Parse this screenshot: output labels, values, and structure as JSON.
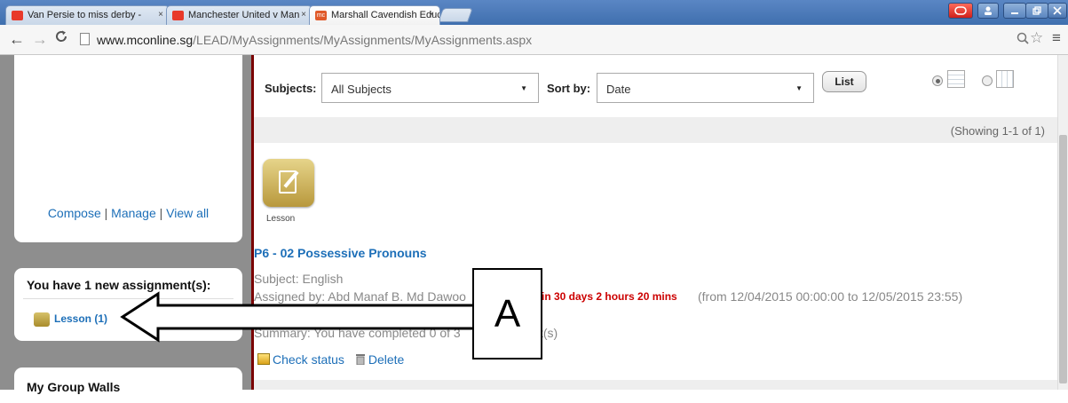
{
  "browser": {
    "tabs": [
      {
        "title": "Van Persie to miss derby -",
        "favicon_color": "#e8392a"
      },
      {
        "title": "Manchester United v Man",
        "favicon_color": "#e8392a"
      },
      {
        "title": "Marshall Cavendish Educa",
        "favicon_color": "#e05a2a",
        "favicon_text": "mc"
      }
    ],
    "close_glyph": "×",
    "url_host": "www.mconline.sg",
    "url_path": "/LEAD/MyAssignments/MyAssignments/MyAssignments.aspx"
  },
  "sidebar": {
    "compose": "Compose",
    "manage": "Manage",
    "view_all": "View all",
    "assignments_title": "You have 1 new assignment(s):",
    "lesson_link": "Lesson (1)",
    "group_walls_title": "My Group Walls"
  },
  "filters": {
    "subjects_label": "Subjects:",
    "subjects_value": "All Subjects",
    "sortby_label": "Sort by:",
    "sortby_value": "Date",
    "list_button": "List",
    "view_list_selected": true
  },
  "results": {
    "showing": "(Showing 1-1 of 1)"
  },
  "assignment": {
    "type_caption": "Lesson",
    "title": "P6 - 02 Possessive Pronouns",
    "subject": "Subject: English",
    "assigned_by": "Assigned by: Abd Manaf B. Md Dawoo",
    "due": "in 30 days 2 hours 20 mins",
    "range": "(from 12/04/2015 00:00:00 to 12/05/2015 23:55)",
    "summary_start": "Summary: You have completed 0 of 3",
    "summary_end": "ct(s)",
    "check_status": "Check status",
    "delete": "Delete"
  },
  "annotation": {
    "label": "A"
  }
}
